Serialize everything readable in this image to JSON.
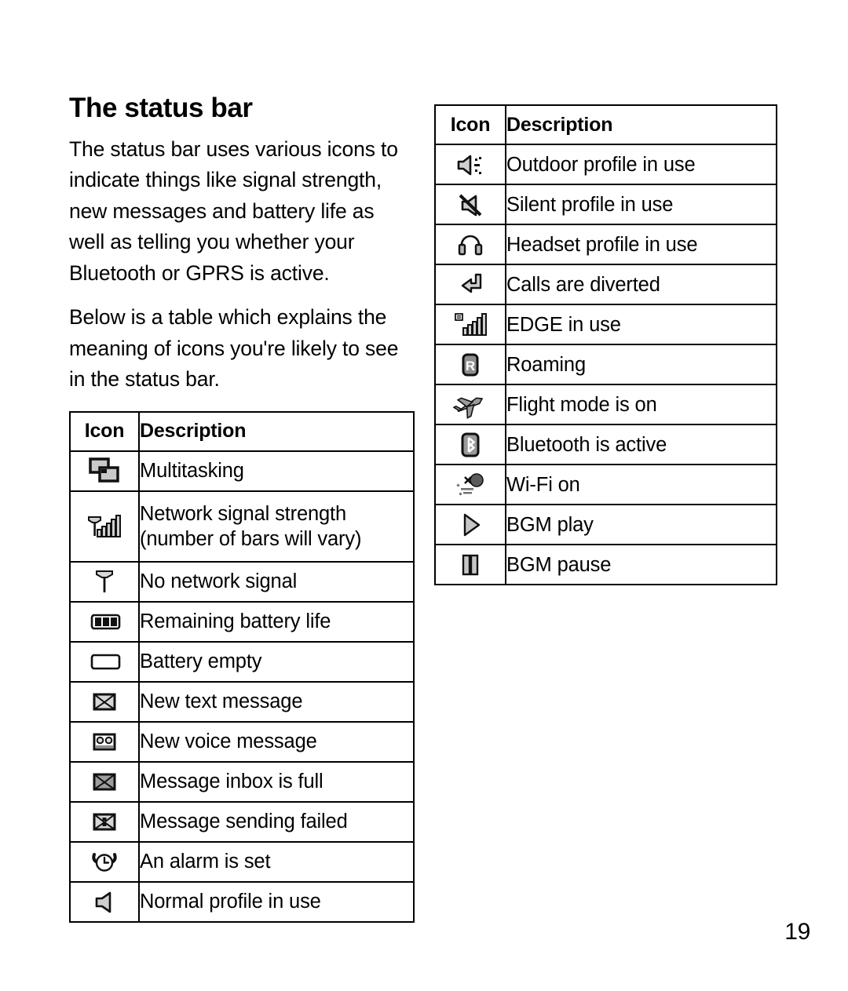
{
  "page": {
    "number": "19"
  },
  "section": {
    "heading": "The status bar",
    "paragraphs": [
      "The status bar uses various icons to indicate things like signal strength, new messages and battery life as well as telling you whether your Bluetooth or GPRS is active.",
      "Below is a table which explains the meaning of icons you're likely to see in the status bar."
    ]
  },
  "tables": {
    "left": {
      "headers": {
        "icon": "Icon",
        "description": "Description"
      },
      "rows": [
        {
          "icon_name": "multitasking-icon",
          "description": "Multitasking"
        },
        {
          "icon_name": "network-signal-strength-icon",
          "description": "Network signal strength (number of bars will vary)"
        },
        {
          "icon_name": "no-network-signal-icon",
          "description": "No network signal"
        },
        {
          "icon_name": "battery-remaining-icon",
          "description": "Remaining battery life"
        },
        {
          "icon_name": "battery-empty-icon",
          "description": "Battery empty"
        },
        {
          "icon_name": "new-text-message-icon",
          "description": "New text message"
        },
        {
          "icon_name": "new-voice-message-icon",
          "description": "New voice message"
        },
        {
          "icon_name": "message-inbox-full-icon",
          "description": "Message inbox is full"
        },
        {
          "icon_name": "message-sending-failed-icon",
          "description": "Message sending failed"
        },
        {
          "icon_name": "alarm-set-icon",
          "description": "An alarm is set"
        },
        {
          "icon_name": "normal-profile-icon",
          "description": "Normal profile in use"
        }
      ]
    },
    "right": {
      "headers": {
        "icon": "Icon",
        "description": "Description"
      },
      "rows": [
        {
          "icon_name": "outdoor-profile-icon",
          "description": "Outdoor profile in use"
        },
        {
          "icon_name": "silent-profile-icon",
          "description": "Silent profile in use"
        },
        {
          "icon_name": "headset-profile-icon",
          "description": "Headset profile in use"
        },
        {
          "icon_name": "calls-diverted-icon",
          "description": "Calls are diverted"
        },
        {
          "icon_name": "edge-in-use-icon",
          "description": "EDGE in use"
        },
        {
          "icon_name": "roaming-icon",
          "description": "Roaming"
        },
        {
          "icon_name": "flight-mode-icon",
          "description": "Flight mode is on"
        },
        {
          "icon_name": "bluetooth-active-icon",
          "description": "Bluetooth is active"
        },
        {
          "icon_name": "wifi-on-icon",
          "description": "Wi-Fi on"
        },
        {
          "icon_name": "bgm-play-icon",
          "description": "BGM play"
        },
        {
          "icon_name": "bgm-pause-icon",
          "description": "BGM pause"
        }
      ]
    }
  },
  "colors": {
    "text": "#000000",
    "rule": "#000000",
    "icon_fill": "#b3b3b3",
    "icon_fill_dark": "#6e6e6e",
    "background": "#ffffff"
  }
}
